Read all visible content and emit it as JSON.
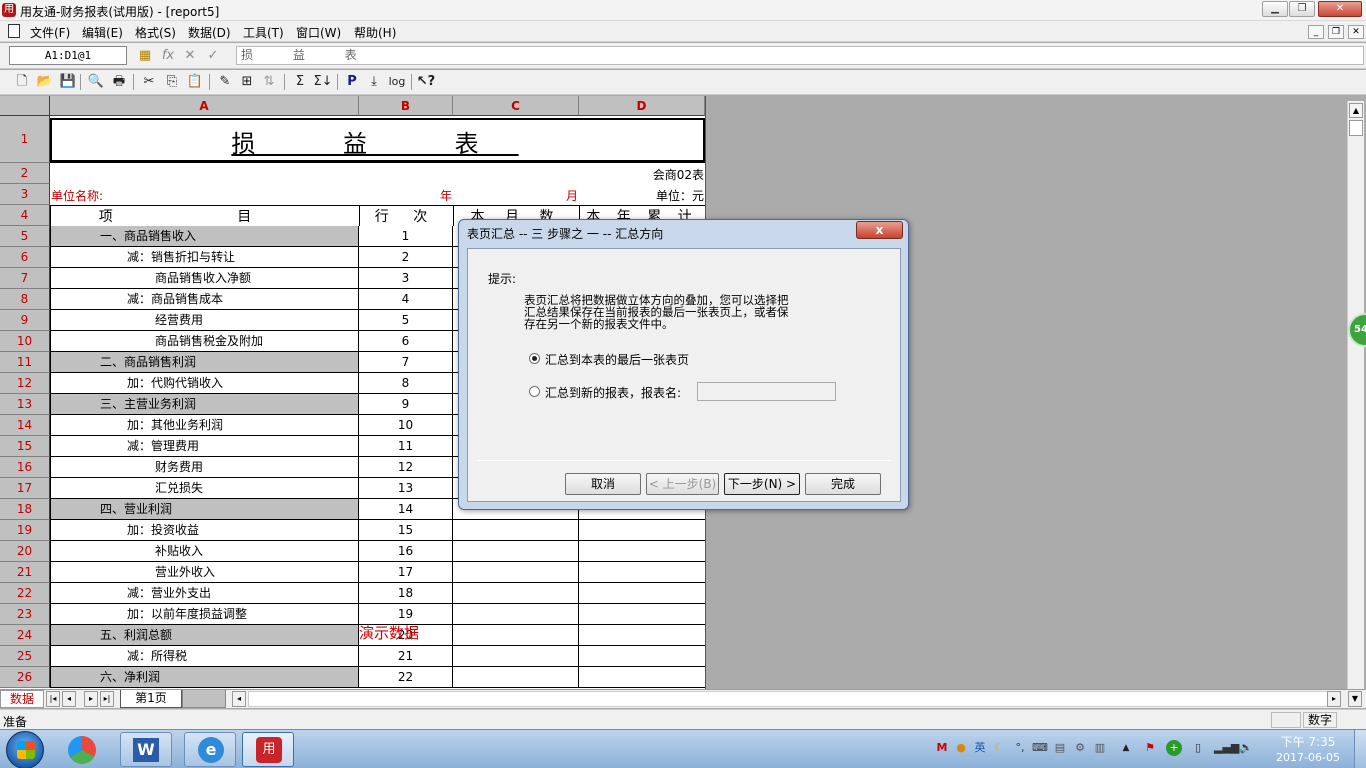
{
  "window": {
    "title": "用友通-财务报表(试用版) - [report5]"
  },
  "menu": [
    "文件(F)",
    "编辑(E)",
    "格式(S)",
    "数据(D)",
    "工具(T)",
    "窗口(W)",
    "帮助(H)"
  ],
  "formula": {
    "cell_ref": "A1:D1@1",
    "content": "损 益 表"
  },
  "columns": [
    "A",
    "B",
    "C",
    "D"
  ],
  "sheet": {
    "title": "损 益 表",
    "form_no": "会商02表",
    "unit_label": "单位名称:",
    "year": "年",
    "month": "月",
    "unit": "单位：元",
    "headers": [
      "项 目",
      "行 次",
      "本 月 数",
      "本 年 累 计"
    ],
    "rows": [
      {
        "item": "一、商品销售收入",
        "line": "1",
        "shaded": true,
        "indent": 1
      },
      {
        "item": "减：销售折扣与转让",
        "line": "2",
        "shaded": false,
        "indent": 2
      },
      {
        "item": "商品销售收入净额",
        "line": "3",
        "shaded": false,
        "indent": 3
      },
      {
        "item": "减：商品销售成本",
        "line": "4",
        "shaded": false,
        "indent": 2
      },
      {
        "item": "经营费用",
        "line": "5",
        "shaded": false,
        "indent": 3
      },
      {
        "item": "商品销售税金及附加",
        "line": "6",
        "shaded": false,
        "indent": 3
      },
      {
        "item": "二、商品销售利润",
        "line": "7",
        "shaded": true,
        "indent": 1
      },
      {
        "item": "加：代购代销收入",
        "line": "8",
        "shaded": false,
        "indent": 2
      },
      {
        "item": "三、主营业务利润",
        "line": "9",
        "shaded": true,
        "indent": 1
      },
      {
        "item": "加：其他业务利润",
        "line": "10",
        "shaded": false,
        "indent": 2
      },
      {
        "item": "减：管理费用",
        "line": "11",
        "shaded": false,
        "indent": 2
      },
      {
        "item": "财务费用",
        "line": "12",
        "shaded": false,
        "indent": 3
      },
      {
        "item": "汇兑损失",
        "line": "13",
        "shaded": false,
        "indent": 3
      },
      {
        "item": "四、营业利润",
        "line": "14",
        "shaded": true,
        "indent": 1
      },
      {
        "item": "加：投资收益",
        "line": "15",
        "shaded": false,
        "indent": 2
      },
      {
        "item": "补贴收入",
        "line": "16",
        "shaded": false,
        "indent": 3
      },
      {
        "item": "营业外收入",
        "line": "17",
        "shaded": false,
        "indent": 3
      },
      {
        "item": "减：营业外支出",
        "line": "18",
        "shaded": false,
        "indent": 2
      },
      {
        "item": "加：以前年度损益调整",
        "line": "19",
        "shaded": false,
        "indent": 2
      },
      {
        "item": "五、利润总额",
        "line": "20",
        "shaded": true,
        "indent": 1
      },
      {
        "item": "减：所得税",
        "line": "21",
        "shaded": false,
        "indent": 2
      },
      {
        "item": "六、净利润",
        "line": "22",
        "shaded": true,
        "indent": 1
      }
    ],
    "demo_watermark": "演示数据"
  },
  "tabs": {
    "mode": "数据",
    "sheet": "第1页"
  },
  "status": {
    "left": "准备",
    "right": "数字"
  },
  "dialog": {
    "title": "表页汇总 -- 三 步骤之 一 -- 汇总方向",
    "hint_label": "提示:",
    "hint_lines": [
      "表页汇总将把数据做立体方向的叠加，您可以选择把",
      "汇总结果保存在当前报表的最后一张表页上，或者保",
      "存在另一个新的报表文件中。"
    ],
    "option1": "汇总到本表的最后一张表页",
    "option2": "汇总到新的报表，报表名:",
    "report_name": "",
    "cancel": "取消",
    "prev": "< 上一步(B)",
    "next": "下一步(N) >",
    "finish": "完成",
    "close": "x"
  },
  "taskbar": {
    "time": "下午 7:35",
    "date": "2017-06-05",
    "badge": "54"
  }
}
